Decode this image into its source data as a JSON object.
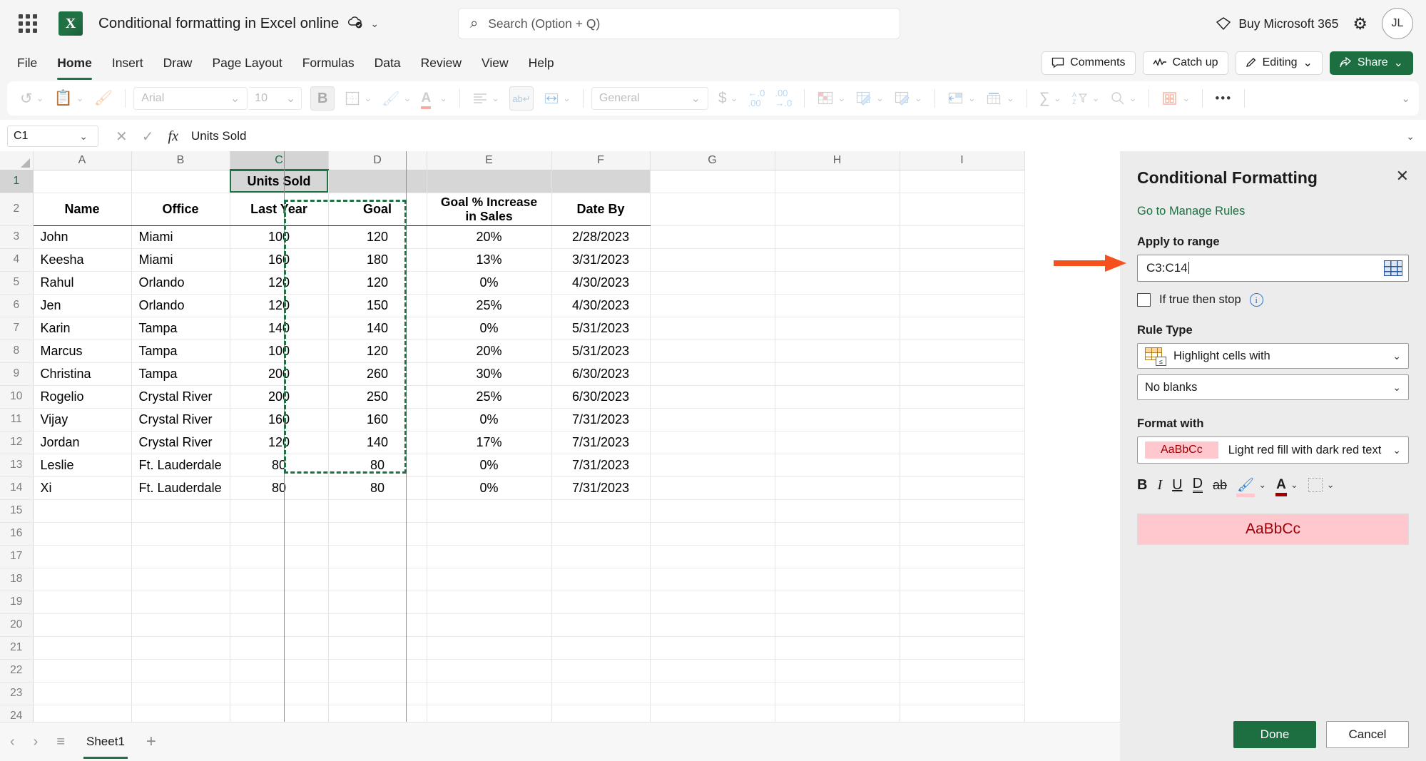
{
  "titlebar": {
    "app_launcher": "waffle-icon",
    "app_logo_letter": "X",
    "document_title": "Conditional formatting in Excel online",
    "autosave_badge": "cloud-saved-icon",
    "title_chevron": "⌄",
    "search_placeholder": "Search (Option + Q)",
    "buy_label": "Buy Microsoft 365",
    "settings_label": "gear-icon",
    "avatar_initials": "JL"
  },
  "menubar": {
    "tabs": [
      {
        "label": "File",
        "active": false
      },
      {
        "label": "Home",
        "active": true
      },
      {
        "label": "Insert",
        "active": false
      },
      {
        "label": "Draw",
        "active": false
      },
      {
        "label": "Page Layout",
        "active": false
      },
      {
        "label": "Formulas",
        "active": false
      },
      {
        "label": "Data",
        "active": false
      },
      {
        "label": "Review",
        "active": false
      },
      {
        "label": "View",
        "active": false
      },
      {
        "label": "Help",
        "active": false
      }
    ],
    "comments_label": "Comments",
    "catchup_label": "Catch up",
    "editing_label": "Editing",
    "share_label": "Share"
  },
  "ribbon": {
    "undo": "undo-icon",
    "paste": "paste-icon",
    "format_painter": "format-painter-icon",
    "font_name": "Arial",
    "font_size": "10",
    "bold": "B",
    "borders": "borders-icon",
    "fill_color": "fill-color-icon",
    "font_color": "A",
    "align": "align-left-icon",
    "wrap_text": "wrap-text-icon",
    "merge": "merge-cells-icon",
    "number_format": "General",
    "currency": "$",
    "decrease_decimal": "decrease-decimal-icon",
    "increase_decimal": "increase-decimal-icon",
    "conditional_formatting": "conditional-formatting-icon",
    "format_as_table": "format-as-table-icon",
    "cell_styles": "cell-styles-icon",
    "insert_cells": "insert-cells-icon",
    "delete_cells": "delete-cells-icon",
    "autosum": "∑",
    "sort_filter": "sort-filter-icon",
    "find": "find-icon",
    "addins": "addins-icon",
    "more": "•••",
    "collapse": "⌄"
  },
  "formulabar": {
    "name_box": "C1",
    "cancel_icon": "✕",
    "enter_icon": "✓",
    "fx_icon": "fx",
    "formula_value": "Units Sold"
  },
  "grid": {
    "columns": [
      "A",
      "B",
      "C",
      "D",
      "E",
      "F",
      "G",
      "H",
      "I"
    ],
    "selected_column": "C",
    "active_cell": "C1",
    "rows": [
      {
        "num": "1",
        "cells": [
          "",
          "",
          "Units Sold",
          "",
          "",
          "",
          "",
          "",
          ""
        ]
      },
      {
        "num": "2",
        "cells": [
          "Name",
          "Office",
          "Last Year",
          "Goal",
          "Goal % Increase in Sales",
          "Date By",
          "",
          "",
          ""
        ]
      },
      {
        "num": "3",
        "cells": [
          "John",
          "Miami",
          "100",
          "120",
          "20%",
          "2/28/2023",
          "",
          "",
          ""
        ]
      },
      {
        "num": "4",
        "cells": [
          "Keesha",
          "Miami",
          "160",
          "180",
          "13%",
          "3/31/2023",
          "",
          "",
          ""
        ]
      },
      {
        "num": "5",
        "cells": [
          "Rahul",
          "Orlando",
          "120",
          "120",
          "0%",
          "4/30/2023",
          "",
          "",
          ""
        ]
      },
      {
        "num": "6",
        "cells": [
          "Jen",
          "Orlando",
          "120",
          "150",
          "25%",
          "4/30/2023",
          "",
          "",
          ""
        ]
      },
      {
        "num": "7",
        "cells": [
          "Karin",
          "Tampa",
          "140",
          "140",
          "0%",
          "5/31/2023",
          "",
          "",
          ""
        ]
      },
      {
        "num": "8",
        "cells": [
          "Marcus",
          "Tampa",
          "100",
          "120",
          "20%",
          "5/31/2023",
          "",
          "",
          ""
        ]
      },
      {
        "num": "9",
        "cells": [
          "Christina",
          "Tampa",
          "200",
          "260",
          "30%",
          "6/30/2023",
          "",
          "",
          ""
        ]
      },
      {
        "num": "10",
        "cells": [
          "Rogelio",
          "Crystal River",
          "200",
          "250",
          "25%",
          "6/30/2023",
          "",
          "",
          ""
        ]
      },
      {
        "num": "11",
        "cells": [
          "Vijay",
          "Crystal River",
          "160",
          "160",
          "0%",
          "7/31/2023",
          "",
          "",
          ""
        ]
      },
      {
        "num": "12",
        "cells": [
          "Jordan",
          "Crystal River",
          "120",
          "140",
          "17%",
          "7/31/2023",
          "",
          "",
          ""
        ]
      },
      {
        "num": "13",
        "cells": [
          "Leslie",
          "Ft. Lauderdale",
          "80",
          "80",
          "0%",
          "7/31/2023",
          "",
          "",
          ""
        ]
      },
      {
        "num": "14",
        "cells": [
          "Xi",
          "Ft. Lauderdale",
          "80",
          "80",
          "0%",
          "7/31/2023",
          "",
          "",
          ""
        ]
      },
      {
        "num": "15",
        "cells": [
          "",
          "",
          "",
          "",
          "",
          "",
          "",
          "",
          ""
        ]
      },
      {
        "num": "16",
        "cells": [
          "",
          "",
          "",
          "",
          "",
          "",
          "",
          "",
          ""
        ]
      },
      {
        "num": "17",
        "cells": [
          "",
          "",
          "",
          "",
          "",
          "",
          "",
          "",
          ""
        ]
      },
      {
        "num": "18",
        "cells": [
          "",
          "",
          "",
          "",
          "",
          "",
          "",
          "",
          ""
        ]
      },
      {
        "num": "19",
        "cells": [
          "",
          "",
          "",
          "",
          "",
          "",
          "",
          "",
          ""
        ]
      },
      {
        "num": "20",
        "cells": [
          "",
          "",
          "",
          "",
          "",
          "",
          "",
          "",
          ""
        ]
      },
      {
        "num": "21",
        "cells": [
          "",
          "",
          "",
          "",
          "",
          "",
          "",
          "",
          ""
        ]
      },
      {
        "num": "22",
        "cells": [
          "",
          "",
          "",
          "",
          "",
          "",
          "",
          "",
          ""
        ]
      },
      {
        "num": "23",
        "cells": [
          "",
          "",
          "",
          "",
          "",
          "",
          "",
          "",
          ""
        ]
      },
      {
        "num": "24",
        "cells": [
          "",
          "",
          "",
          "",
          "",
          "",
          "",
          "",
          ""
        ]
      }
    ]
  },
  "bottombar": {
    "prev_icon": "‹",
    "next_icon": "›",
    "all_sheets_icon": "≡",
    "sheet_name": "Sheet1",
    "add_sheet_icon": "+"
  },
  "panel": {
    "title": "Conditional Formatting",
    "close_icon": "✕",
    "manage_rules_link": "Go to Manage Rules",
    "apply_to_range_label": "Apply to range",
    "apply_to_range_value": "C3:C14",
    "range_picker_icon": "range-picker-icon",
    "if_true_stop_label": "If true then stop",
    "if_true_stop_checked": false,
    "info_icon": "i",
    "rule_type_label": "Rule Type",
    "rule_type_value": "Highlight cells with",
    "rule_condition_value": "No blanks",
    "format_with_label": "Format with",
    "format_chip_text": "AaBbCc",
    "format_with_value": "Light red fill with dark red text",
    "format_tools": [
      "B",
      "I",
      "U",
      "D",
      "ab",
      "fill-color-icon",
      "font-color-icon",
      "borders-icon"
    ],
    "preview_text": "AaBbCc",
    "done_label": "Done",
    "cancel_label": "Cancel"
  },
  "annotation": {
    "arrow": "orange-arrow-pointing-to-range-input",
    "arrow_color": "#F4511E"
  },
  "colors": {
    "brand_green": "#217346",
    "panel_bg": "#ECECEC",
    "selection_green": "#1E7145",
    "light_red_fill": "#FFC7CE",
    "dark_red_text": "#9C0006"
  }
}
